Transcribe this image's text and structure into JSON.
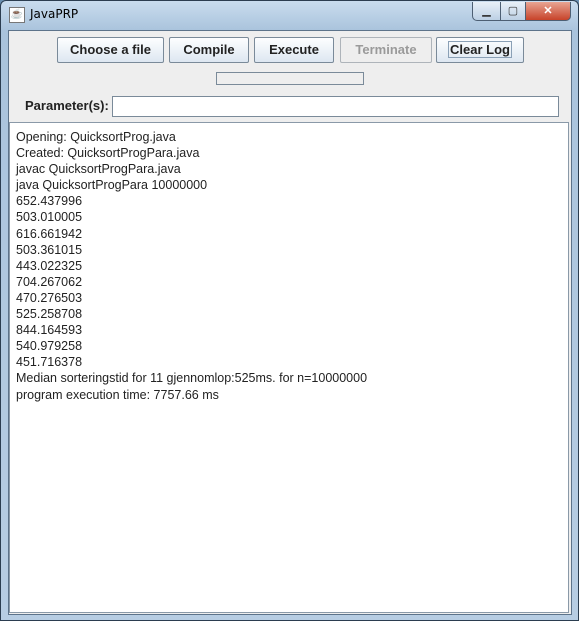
{
  "window": {
    "title": "JavaPRP",
    "app_icon": "java-cup-icon",
    "controls": [
      "minimize",
      "maximize",
      "close"
    ]
  },
  "toolbar": {
    "choose_file": "Choose a file",
    "compile": "Compile",
    "execute": "Execute",
    "terminate": "Terminate",
    "clear_log": "Clear Log",
    "terminate_enabled": false
  },
  "progress": {
    "value": 0
  },
  "parameters": {
    "label": "Parameter(s):",
    "value": ""
  },
  "log": {
    "lines": [
      "Opening: QuicksortProg.java",
      "Created: QuicksortProgPara.java",
      "javac QuicksortProgPara.java",
      "java QuicksortProgPara 10000000",
      "652.437996",
      "503.010005",
      "616.661942",
      "503.361015",
      "443.022325",
      "704.267062",
      "470.276503",
      "525.258708",
      "844.164593",
      "540.979258",
      "451.716378",
      "Median sorteringstid for 11 gjennomlop:525ms. for n=10000000",
      "program execution time: 7757.66 ms"
    ]
  }
}
